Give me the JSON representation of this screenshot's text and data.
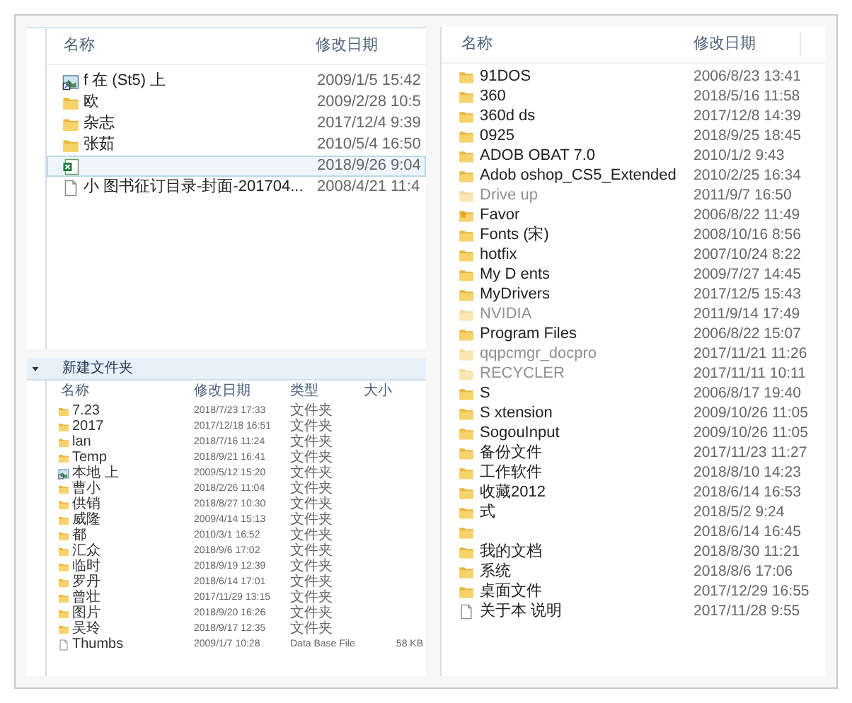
{
  "top_window": {
    "columns": [
      "名称",
      "修改日期"
    ],
    "rows": [
      {
        "kind": "shortcut",
        "name": "f 在 (St5) 上",
        "date": "2009/1/5 15:42",
        "selected": false
      },
      {
        "kind": "folder",
        "name": "欧",
        "date": "2009/2/28 10:5",
        "selected": false
      },
      {
        "kind": "folder",
        "name": "杂志",
        "date": "2017/12/4 9:39",
        "selected": false
      },
      {
        "kind": "folder",
        "name": "张茹",
        "date": "2010/5/4 16:50",
        "selected": false
      },
      {
        "kind": "excel",
        "date": "2018/9/26 9:04",
        "selected": true
      },
      {
        "kind": "file",
        "name": "小 图书征订目录-封面-201704...",
        "date": "2008/4/21 11:4",
        "selected": false
      }
    ]
  },
  "bottom_window": {
    "toolbar": {
      "new_folder": "新建文件夹"
    },
    "columns": [
      "名称",
      "修改日期",
      "类型",
      "大小"
    ],
    "rows": [
      {
        "kind": "folder",
        "name": "7.23",
        "date": "2018/7/23 17:33",
        "type": "文件夹"
      },
      {
        "kind": "folder",
        "name": "2017",
        "date": "2017/12/18 16:51",
        "type": "文件夹"
      },
      {
        "kind": "folder",
        "name": "lan",
        "date": "2018/7/16 11:24",
        "type": "文件夹"
      },
      {
        "kind": "folder",
        "name": "Temp",
        "date": "2018/9/21 16:41",
        "type": "文件夹"
      },
      {
        "kind": "shortcut",
        "name": "本地 上",
        "date": "2009/5/12 15:20",
        "type": "文件夹"
      },
      {
        "kind": "folder",
        "name": "曹小",
        "date": "2018/2/26 11:04",
        "type": "文件夹"
      },
      {
        "kind": "folder",
        "name": "供销",
        "date": "2018/8/27 10:30",
        "type": "文件夹"
      },
      {
        "kind": "folder",
        "name": "威隆",
        "date": "2009/4/14 15:13",
        "type": "文件夹"
      },
      {
        "kind": "folder",
        "name": "都",
        "date": "2010/3/1 16:52",
        "type": "文件夹"
      },
      {
        "kind": "folder",
        "name": "汇众",
        "date": "2018/9/6 17:02",
        "type": "文件夹"
      },
      {
        "kind": "folder",
        "name": "临时",
        "date": "2018/9/19 12:39",
        "type": "文件夹"
      },
      {
        "kind": "folder",
        "name": "罗丹",
        "date": "2018/6/14 17:01",
        "type": "文件夹"
      },
      {
        "kind": "folder",
        "name": "曾壮",
        "date": "2017/11/29 13:15",
        "type": "文件夹"
      },
      {
        "kind": "folder",
        "name": "图片",
        "date": "2018/9/20 16:26",
        "type": "文件夹"
      },
      {
        "kind": "folder",
        "name": "吴玲",
        "date": "2018/9/17 12:35",
        "type": "文件夹"
      },
      {
        "kind": "file",
        "name": "Thumbs",
        "date": "2009/1/7 10:28",
        "type": "Data Base File",
        "size": "58 KB"
      }
    ]
  },
  "right_window": {
    "columns": [
      "名称",
      "修改日期"
    ],
    "rows": [
      {
        "kind": "folder",
        "name": "91DOS",
        "date": "2006/8/23 13:41",
        "hidden": false
      },
      {
        "kind": "folder",
        "name": "360",
        "date": "2018/5/16 11:58",
        "hidden": false
      },
      {
        "kind": "folder",
        "name": "360d ds",
        "date": "2017/12/8 14:39",
        "hidden": false
      },
      {
        "kind": "folder",
        "name": "0925",
        "date": "2018/9/25 18:45",
        "hidden": false
      },
      {
        "kind": "folder",
        "name": "ADOB OBAT 7.0",
        "date": "2010/1/2 9:43",
        "hidden": false
      },
      {
        "kind": "folder",
        "name": "Adob oshop_CS5_Extended",
        "date": "2010/2/25 16:34",
        "hidden": false
      },
      {
        "kind": "folder",
        "name": "Drive up",
        "date": "2011/9/7 16:50",
        "hidden": true
      },
      {
        "kind": "favorites",
        "name": "Favor",
        "date": "2006/8/22 11:49",
        "hidden": false
      },
      {
        "kind": "folder",
        "name": "Fonts (宋)",
        "date": "2008/10/16 8:56",
        "hidden": false
      },
      {
        "kind": "folder",
        "name": "hotfix",
        "date": "2007/10/24 8:22",
        "hidden": false
      },
      {
        "kind": "folder",
        "name": "My D ents",
        "date": "2009/7/27 14:45",
        "hidden": false
      },
      {
        "kind": "folder",
        "name": "MyDrivers",
        "date": "2017/12/5 15:43",
        "hidden": false
      },
      {
        "kind": "folder",
        "name": "NVIDIA",
        "date": "2011/9/14 17:49",
        "hidden": true
      },
      {
        "kind": "folder",
        "name": "Program Files",
        "date": "2006/8/22 15:07",
        "hidden": false
      },
      {
        "kind": "folder",
        "name": "qqpcmgr_docpro",
        "date": "2017/11/21 11:26",
        "hidden": true
      },
      {
        "kind": "folder",
        "name": "RECYCLER",
        "date": "2017/11/11 10:11",
        "hidden": true
      },
      {
        "kind": "folder",
        "name": "S",
        "date": "2006/8/17 19:40",
        "hidden": false
      },
      {
        "kind": "folder",
        "name": "S xtension",
        "date": "2009/10/26 11:05",
        "hidden": false
      },
      {
        "kind": "folder",
        "name": "SogouInput",
        "date": "2009/10/26 11:05",
        "hidden": false
      },
      {
        "kind": "folder",
        "name": "备份文件",
        "date": "2017/11/23 11:27",
        "hidden": false
      },
      {
        "kind": "folder",
        "name": "工作软件",
        "date": "2018/8/10 14:23",
        "hidden": false
      },
      {
        "kind": "folder",
        "name": "收藏2012",
        "date": "2018/6/14 16:53",
        "hidden": false
      },
      {
        "kind": "folder",
        "name": "式",
        "date": "2018/5/2 9:24",
        "hidden": false
      },
      {
        "kind": "folder",
        "date": "2018/6/14 16:45",
        "hidden": false
      },
      {
        "kind": "folder",
        "name": "我的文档",
        "date": "2018/8/30 11:21",
        "hidden": false
      },
      {
        "kind": "folder",
        "name": "系统",
        "date": "2018/8/6 17:06",
        "hidden": false
      },
      {
        "kind": "folder",
        "name": "桌面文件",
        "date": "2017/12/29 16:55",
        "hidden": false
      },
      {
        "kind": "file",
        "name": "关于本 说明",
        "date": "2017/11/28 9:55",
        "hidden": false
      }
    ]
  }
}
